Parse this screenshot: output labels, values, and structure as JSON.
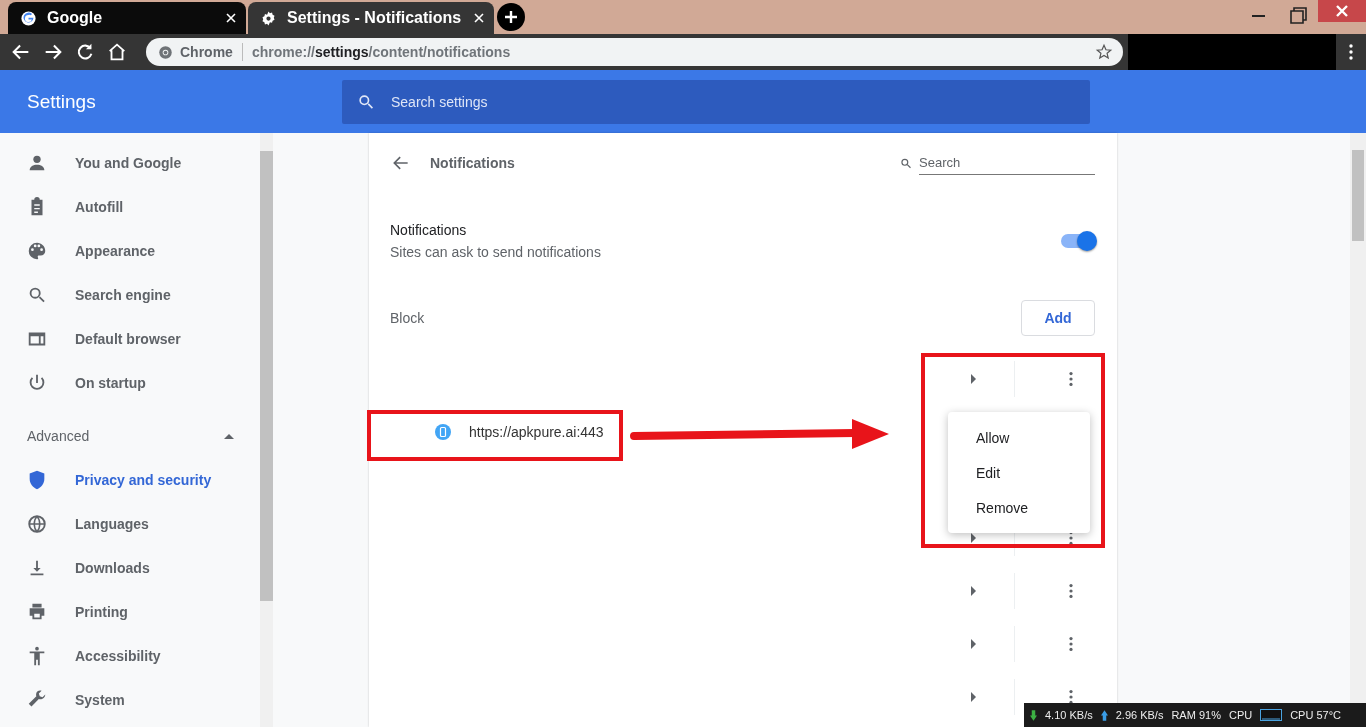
{
  "tabs": [
    {
      "title": "Google",
      "selected": false
    },
    {
      "title": "Settings - Notifications",
      "selected": true
    }
  ],
  "toolbar": {
    "chip": "Chrome",
    "url": "chrome://**settings**/content/notifications"
  },
  "header": {
    "title": "Settings",
    "search": {
      "placeholder": "Search settings"
    }
  },
  "sidebar": {
    "items": [
      {
        "label": "You and Google",
        "selected": false
      },
      {
        "label": "Autofill",
        "selected": false
      },
      {
        "label": "Appearance",
        "selected": false
      },
      {
        "label": "Search engine",
        "selected": false
      },
      {
        "label": "Default browser",
        "selected": false
      },
      {
        "label": "On startup",
        "selected": false
      }
    ],
    "advanced": {
      "label": "Advanced",
      "expanded": true
    },
    "advanced_items": [
      {
        "label": "Privacy and security",
        "selected": true
      },
      {
        "label": "Languages",
        "selected": false
      },
      {
        "label": "Downloads",
        "selected": false
      },
      {
        "label": "Printing",
        "selected": false
      },
      {
        "label": "Accessibility",
        "selected": false
      },
      {
        "label": "System",
        "selected": false
      }
    ]
  },
  "page": {
    "title": "Notifications",
    "search": {
      "placeholder": "Search"
    },
    "setting": {
      "title": "Notifications",
      "description": "Sites can ask to send notifications",
      "on": true
    },
    "block": {
      "label": "Block",
      "add_button": "Add"
    },
    "rows": [
      {
        "kind": "controls"
      },
      {
        "kind": "site",
        "site": "https://apkpure.ai:443"
      },
      {
        "kind": "covered"
      },
      {
        "kind": "controls"
      },
      {
        "kind": "controls"
      },
      {
        "kind": "controls"
      },
      {
        "kind": "controls"
      }
    ],
    "menu": {
      "items": [
        "Allow",
        "Edit",
        "Remove"
      ]
    }
  },
  "meter": {
    "down": "4.10 KB/s",
    "up": "2.96 KB/s",
    "ram": "RAM 91%",
    "cpu_graph": "CPU",
    "cpu_temp": "CPU 57°C"
  }
}
